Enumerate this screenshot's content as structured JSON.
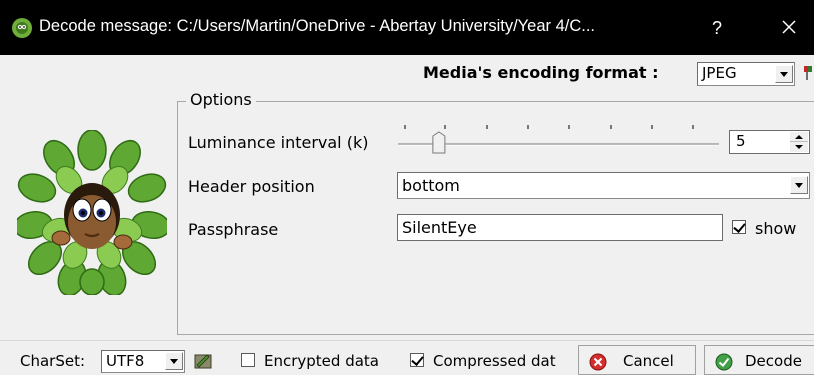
{
  "window": {
    "title": "Decode message: C:/Users/Martin/OneDrive - Abertay University/Year 4/C...",
    "help_label": "?"
  },
  "media": {
    "label": "Media's encoding format :",
    "format_value": "JPEG"
  },
  "options": {
    "group_title": "Options",
    "luminance": {
      "label": "Luminance interval (k)",
      "value": "5",
      "slider_position": 0.11
    },
    "header_position": {
      "label": "Header position",
      "value": "bottom"
    },
    "passphrase": {
      "label": "Passphrase",
      "value": "SilentEye",
      "show_label": "show",
      "show_checked": true
    }
  },
  "bottom": {
    "charset_label": "CharSet:",
    "charset_value": "UTF8",
    "encrypted_label": "Encrypted data",
    "encrypted_checked": false,
    "compressed_label": "Compressed dat",
    "compressed_checked": true,
    "cancel_label": "Cancel",
    "decode_label": "Decode"
  },
  "colors": {
    "titlebar_bg": "#000000",
    "window_bg": "#f0f0f0",
    "cancel_icon": "#d32f2f",
    "decode_icon": "#43a047"
  }
}
